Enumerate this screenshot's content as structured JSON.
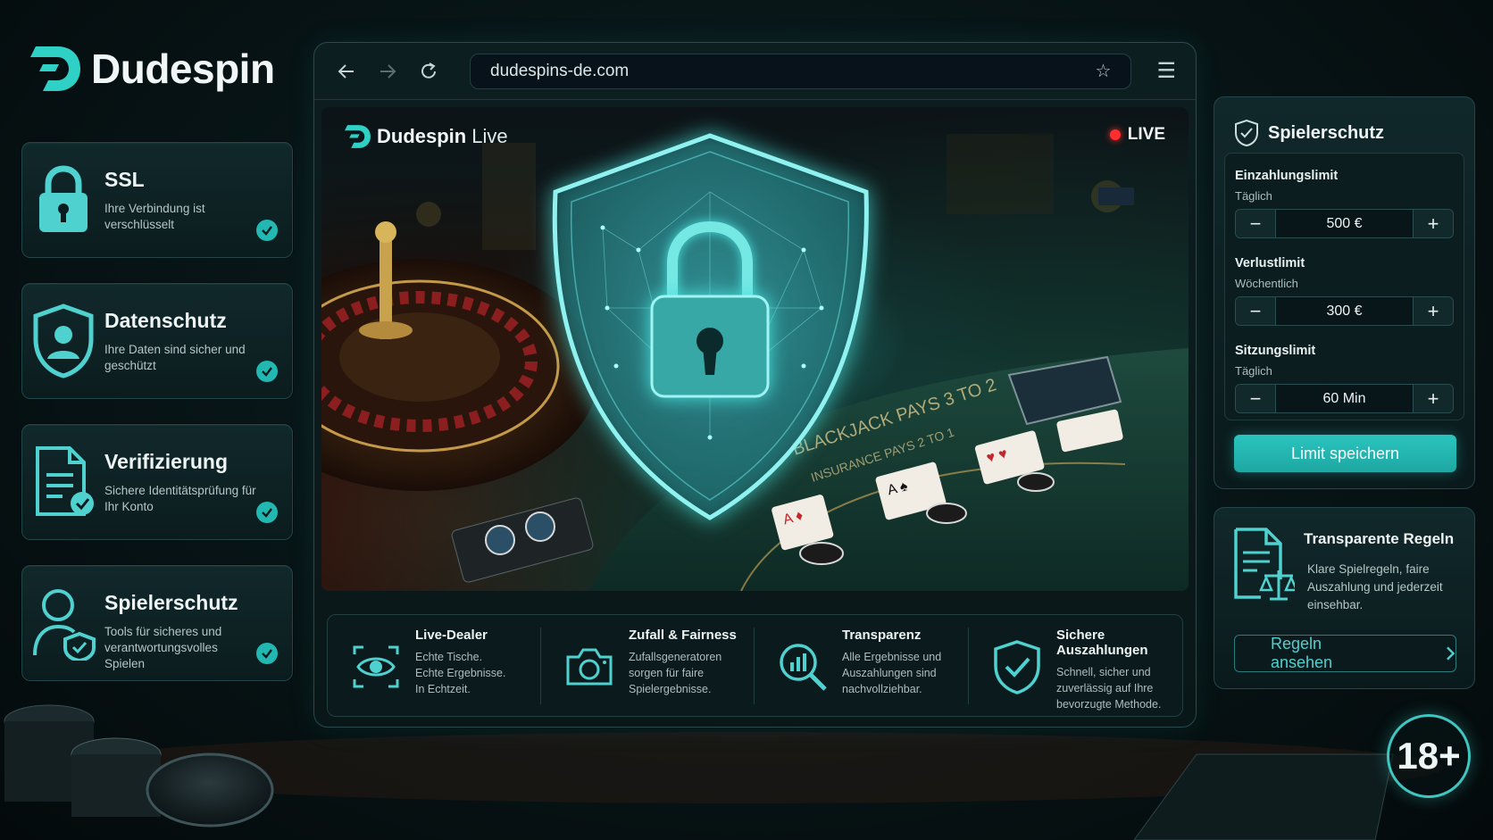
{
  "brand": {
    "name": "Dudespin"
  },
  "features": [
    {
      "title": "SSL",
      "desc": "Ihre Verbindung ist verschlüsselt",
      "icon": "lock-icon"
    },
    {
      "title": "Datenschutz",
      "desc": "Ihre Daten sind sicher und geschützt",
      "icon": "shield-user-icon"
    },
    {
      "title": "Verifizierung",
      "desc": "Sichere Identitätsprüfung für Ihr Konto",
      "icon": "document-check-icon"
    },
    {
      "title": "Spielerschutz",
      "desc": "Tools für sicheres und verantwortungsvolles Spielen",
      "icon": "user-shield-icon"
    }
  ],
  "browser": {
    "url": "dudespins-de.com",
    "stage": {
      "brand_name": "Dudespin",
      "brand_suffix": "Live",
      "live_label": "LIVE"
    }
  },
  "infobar": [
    {
      "title": "Live-Dealer",
      "desc": "Echte Tische. Echte Ergebnisse. In Echtzeit.",
      "icon": "eye-icon"
    },
    {
      "title": "Zufall & Fairness",
      "desc": "Zufallsgeneratoren sorgen für faire Spielergebnisse.",
      "icon": "camera-icon"
    },
    {
      "title": "Transparenz",
      "desc": "Alle Ergebnisse und Auszahlungen sind nachvollziehbar.",
      "icon": "search-chart-icon"
    },
    {
      "title": "Sichere Auszahlungen",
      "desc": "Schnell, sicher und zuverlässig auf Ihre bevorzugte Methode.",
      "icon": "shield-check-icon"
    }
  ],
  "panel": {
    "title": "Spielerschutz",
    "limits": [
      {
        "name": "Einzahlungslimit",
        "period": "Täglich",
        "value": "500 €"
      },
      {
        "name": "Verlustlimit",
        "period": "Wöchentlich",
        "value": "300 €"
      },
      {
        "name": "Sitzungslimit",
        "period": "Täglich",
        "value": "60 Min"
      }
    ],
    "save_label": "Limit speichern"
  },
  "rules": {
    "title": "Transparente Regeln",
    "desc": "Klare Spielregeln, faire Auszahlung und jederzeit einsehbar.",
    "button_label": "Regeln ansehen"
  },
  "age_badge": "18+",
  "colors": {
    "accent": "#2ac4be",
    "background": "#081618",
    "live": "#ff2d2d"
  }
}
